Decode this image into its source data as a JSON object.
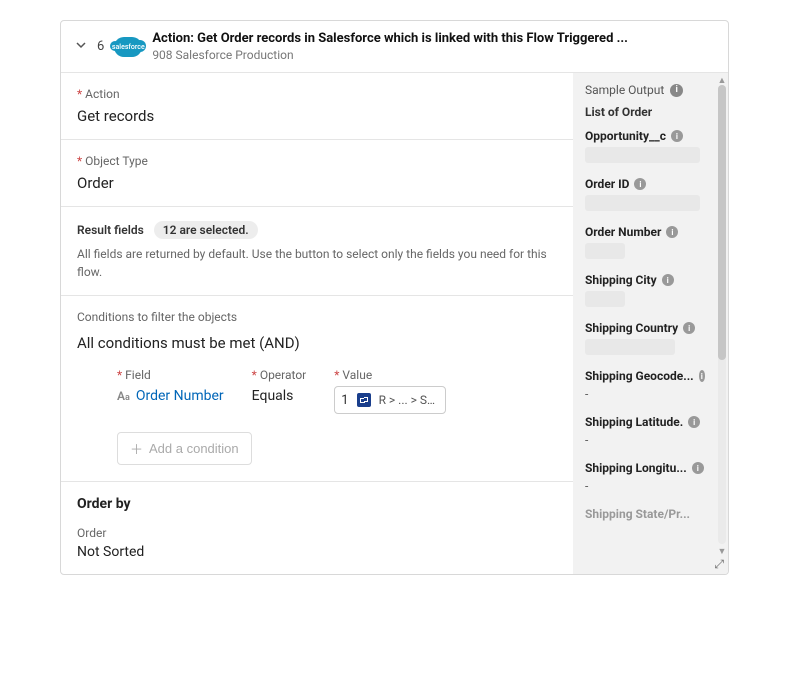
{
  "header": {
    "step_number": "6",
    "app_badge": "salesforce",
    "title": "Action: Get Order records in Salesforce which is linked with this Flow Triggered ...",
    "subtitle": "908 Salesforce Production"
  },
  "action": {
    "label": "Action",
    "value": "Get records"
  },
  "object_type": {
    "label": "Object Type",
    "value": "Order"
  },
  "result_fields": {
    "label": "Result fields",
    "count_text": "12 are selected.",
    "help": "All fields are returned by default. Use the button to select only the fields you need for this flow."
  },
  "conditions": {
    "label": "Conditions to filter the objects",
    "mode": "All conditions must be met (AND)",
    "row": {
      "field_label": "Field",
      "field_value": "Order Number",
      "operator_label": "Operator",
      "operator_value": "Equals",
      "value_label": "Value",
      "value_index": "1",
      "value_path": "R > ... > Sal..."
    },
    "add_btn": "Add a condition"
  },
  "order_by": {
    "heading": "Order by",
    "order_label": "Order",
    "order_value": "Not Sorted"
  },
  "sample": {
    "title": "Sample Output",
    "subtitle": "List of Order",
    "fields": [
      {
        "label": "Opportunity__c",
        "placeholder": "lg"
      },
      {
        "label": "Order ID",
        "placeholder": "lg"
      },
      {
        "label": "Order Number",
        "placeholder": "sm"
      },
      {
        "label": "Shipping City",
        "placeholder": "sm"
      },
      {
        "label": "Shipping Country",
        "placeholder": "md"
      },
      {
        "label": "Shipping Geocode...",
        "dash": "-"
      },
      {
        "label": "Shipping Latitude.",
        "dash": "-"
      },
      {
        "label": "Shipping Longitu...",
        "dash": "-"
      },
      {
        "label": "Shipping State/Pr...",
        "faded": true
      }
    ]
  }
}
